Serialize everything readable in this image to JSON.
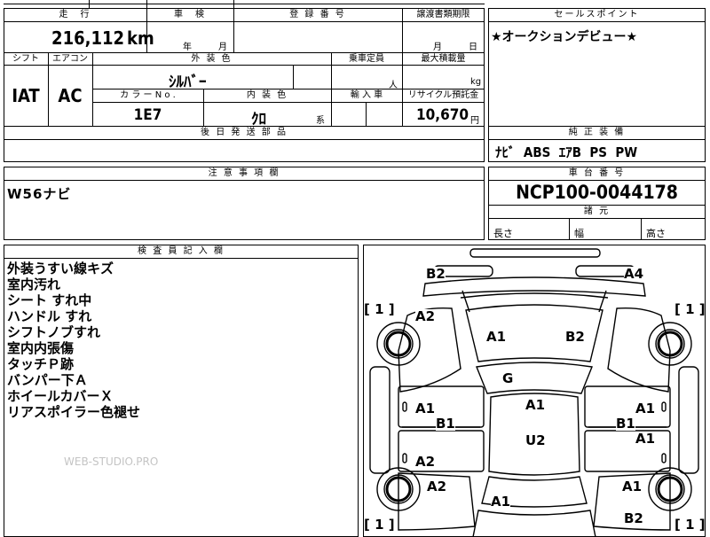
{
  "top_row": {
    "mileage_label": "走　行",
    "shaken_label": "車　検",
    "registration_label": "登 録 番 号",
    "transfer_deadline_label": "譲渡書類期限",
    "mileage_value": "216,112",
    "mileage_unit": "km",
    "shaken_year_unit": "年",
    "shaken_month_unit": "月",
    "transfer_month_unit": "月",
    "transfer_day_unit": "日"
  },
  "second_row": {
    "shift_label": "シフト",
    "aircon_label": "エアコン",
    "exterior_color_label": "外 装 色",
    "capacity_label": "乗車定員",
    "max_load_label": "最大積載量",
    "shift_value": "IAT",
    "aircon_value": "AC",
    "exterior_color_value": "ｼﾙﾊﾞｰ",
    "capacity_unit": "人",
    "max_load_unit": "kg",
    "color_no_label": "カ ラ ー N o .",
    "interior_color_label": "内 装 色",
    "import_label": "輸 入 車",
    "recycle_label": "リサイクル預託金",
    "color_no_value": "1E7",
    "interior_color_value": "ｸﾛ",
    "interior_color_suffix": "系",
    "recycle_value": "10,670",
    "recycle_unit": "円"
  },
  "parts_label": "後 日 発 送 部 品",
  "sales_point": {
    "label": "セールスポイント",
    "text": "★オークションデビュー★"
  },
  "equipment": {
    "label": "純 正 装 備",
    "text": "ﾅﾋﾞ  ABS  ｴｱB  PS  PW"
  },
  "caution": {
    "label": "注 意 事 項 欄",
    "text": "W56ナビ"
  },
  "chassis": {
    "label": "車 台 番 号",
    "value": "NCP100-0044178",
    "dims_label": "諸 元",
    "length_label": "長さ",
    "width_label": "幅",
    "height_label": "高さ"
  },
  "inspector": {
    "label": "検 査 員 記 入 欄",
    "notes": [
      "外装うすい線キズ",
      "室内汚れ",
      "シート すれ中",
      "ハンドル すれ",
      "シフトノブすれ",
      "室内内張傷",
      "タッチＰ跡",
      "バンパー下Ａ",
      "ホイールカバーＸ",
      "リアスポイラー色褪せ"
    ]
  },
  "damage": {
    "top_left": "B2",
    "top_right": "A4",
    "tire_left_top": "[ 1 ]",
    "tire_right_top": "[ 1 ]",
    "front_left": "A2",
    "hood_left": "A1",
    "hood_right": "B2",
    "windshield": "G",
    "roof_front": "A1",
    "left_front_door": "A1",
    "left_front_pillar": "B1",
    "right_front_door": "A1",
    "right_front_pillar": "B1",
    "right_rear_door": "A1",
    "roof_rear": "U2",
    "left_rear_door": "A2",
    "left_rear_fender": "A2",
    "right_rear_fender": "A1",
    "trunk": "A1",
    "rear_right": "B2",
    "tire_left_bottom": "[ 1 ]",
    "tire_right_bottom": "[ 1 ]"
  },
  "watermark": "WEB-STUDIO.PRO"
}
